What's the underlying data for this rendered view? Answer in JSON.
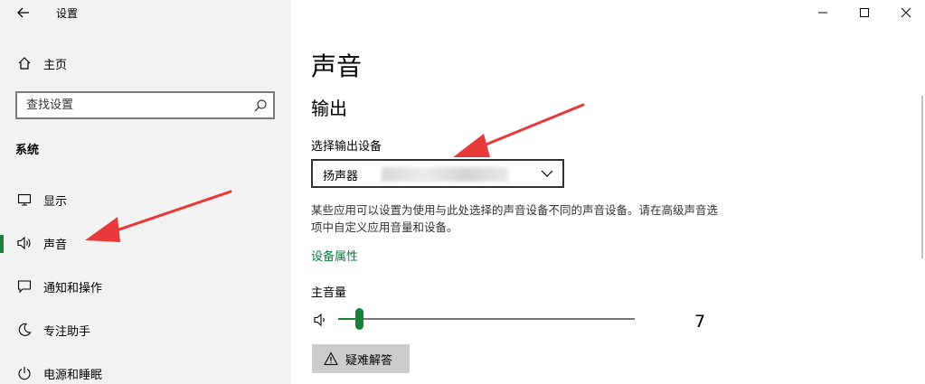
{
  "window": {
    "title": "设置",
    "controls": {
      "minimize": "—",
      "maximize": "☐",
      "close": "✕"
    }
  },
  "sidebar": {
    "home_label": "主页",
    "search_placeholder": "查找设置",
    "section_title": "系统",
    "items": [
      {
        "label": "显示",
        "icon": "display-icon"
      },
      {
        "label": "声音",
        "icon": "speaker-icon",
        "active": true
      },
      {
        "label": "通知和操作",
        "icon": "notification-icon"
      },
      {
        "label": "专注助手",
        "icon": "moon-icon"
      },
      {
        "label": "电源和睡眠",
        "icon": "power-icon"
      }
    ]
  },
  "main": {
    "page_title": "声音",
    "output_heading": "输出",
    "select_label": "选择输出设备",
    "selected_device": "扬声器",
    "help_text": "某些应用可以设置为使用与此处选择的声音设备不同的声音设备。请在高级声音选项中自定义应用音量和设备。",
    "device_properties_link": "设备属性",
    "master_volume_label": "主音量",
    "master_volume_value": "7",
    "troubleshoot_label": "疑难解答"
  },
  "colors": {
    "accent": "#1a7f37",
    "annotation_arrow": "#e8393a"
  }
}
